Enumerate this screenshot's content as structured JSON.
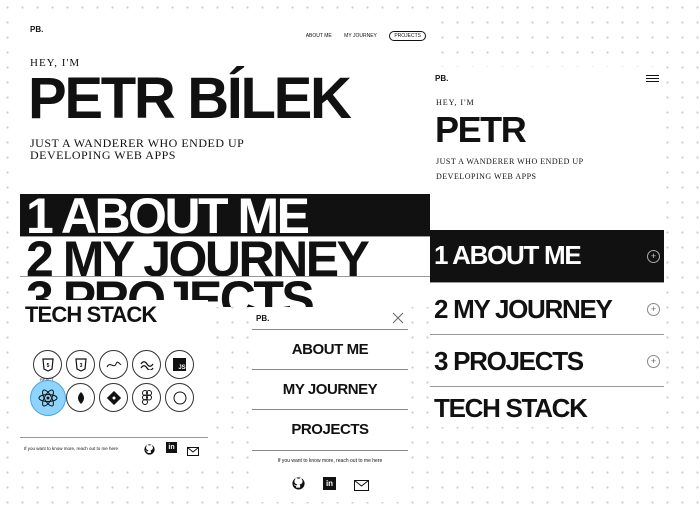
{
  "desktop": {
    "logo": "PB.",
    "nav": [
      "ABOUT ME",
      "MY JOURNEY",
      "PROJECTS"
    ],
    "greeting": "HEY, I'M",
    "name": "PETR BÍLEK",
    "tagline_1": "JUST A WANDERER WHO ENDED UP",
    "tagline_2": "DEVELOPING WEB APPS",
    "menu": [
      "1 ABOUT ME",
      "2 MY JOURNEY",
      "3 PROJECTS"
    ]
  },
  "tech_panel": {
    "title": "TECH STACK",
    "icons": [
      "html5-icon",
      "css3-icon",
      "sass-icon",
      "tailwind-icon",
      "js-icon",
      "react-icon",
      "node-icon",
      "git-icon",
      "figma-icon",
      "compass-icon"
    ],
    "react_caption": "REACT",
    "footer_text": "If you want to know more, reach out to me here"
  },
  "overlay_menu": {
    "logo": "PB.",
    "items": [
      "ABOUT ME",
      "MY JOURNEY",
      "PROJECTS"
    ],
    "footer_text": "If you want to know more, reach out to me here"
  },
  "mobile": {
    "logo": "PB.",
    "greeting": "HEY, I'M",
    "name": "PETR",
    "tagline_1": "JUST A WANDERER WHO ENDED UP",
    "tagline_2": "DEVELOPING WEB APPS",
    "menu": [
      "1 ABOUT ME",
      "2 MY JOURNEY",
      "3 PROJECTS"
    ],
    "section_title": "TECH STACK",
    "plus": "+"
  }
}
